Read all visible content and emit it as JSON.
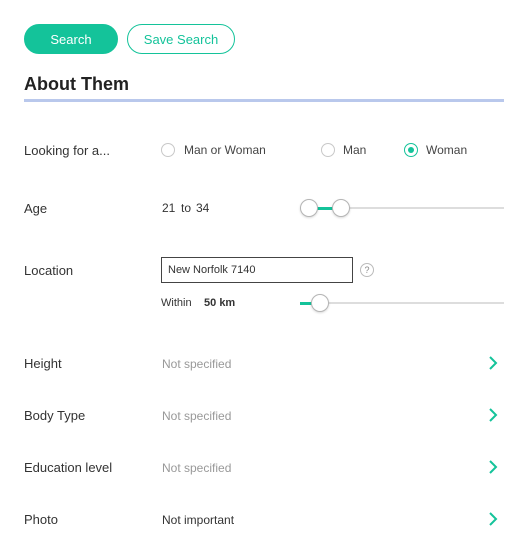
{
  "toolbar": {
    "search_label": "Search",
    "save_search_label": "Save Search"
  },
  "section": {
    "title": "About Them"
  },
  "looking_for": {
    "label": "Looking for a...",
    "options": [
      {
        "label": "Man or Woman",
        "checked": false
      },
      {
        "label": "Man",
        "checked": false
      },
      {
        "label": "Woman",
        "checked": true
      }
    ]
  },
  "age": {
    "label": "Age",
    "min": "21",
    "to": "to",
    "max": "34"
  },
  "location": {
    "label": "Location",
    "value": "New Norfolk 7140",
    "help": "?",
    "within_label": "Within",
    "distance": "50",
    "unit": "km"
  },
  "rows": [
    {
      "label": "Height",
      "value": "Not specified"
    },
    {
      "label": "Body Type",
      "value": "Not specified"
    },
    {
      "label": "Education level",
      "value": "Not specified"
    },
    {
      "label": "Photo",
      "value": "Not important"
    }
  ],
  "colors": {
    "accent": "#14c39a",
    "section_rule": "#b9c8ec"
  }
}
